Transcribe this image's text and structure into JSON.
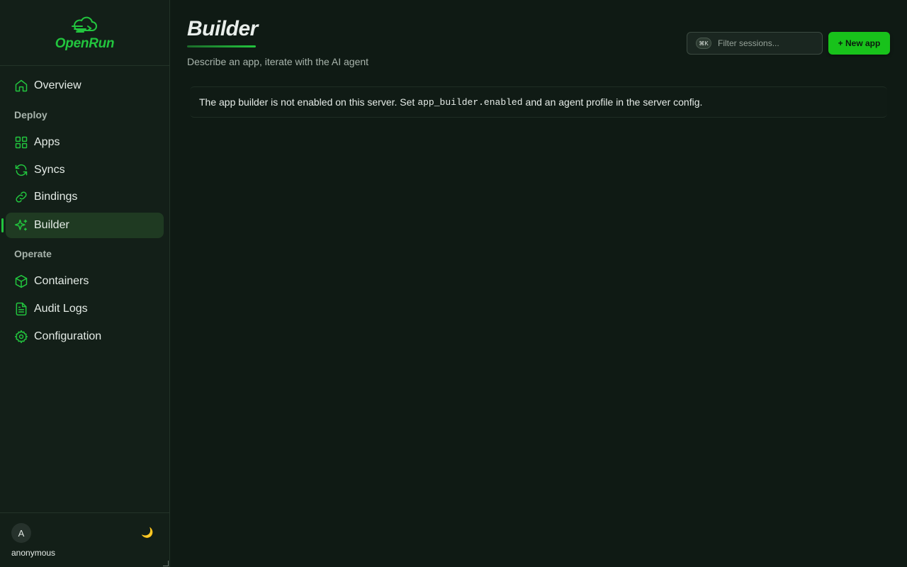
{
  "brand": {
    "name": "OpenRun",
    "logo_icon": "cloud-logo-icon",
    "accent": "#22c53e"
  },
  "sidebar": {
    "items": [
      {
        "label": "Overview",
        "icon": "home-icon"
      },
      {
        "label": "Apps",
        "icon": "grid-icon"
      },
      {
        "label": "Syncs",
        "icon": "refresh-icon"
      },
      {
        "label": "Bindings",
        "icon": "link-icon"
      },
      {
        "label": "Builder",
        "icon": "sparkle-icon",
        "active": true
      },
      {
        "label": "Containers",
        "icon": "box-icon"
      },
      {
        "label": "Audit Logs",
        "icon": "file-text-icon"
      },
      {
        "label": "Configuration",
        "icon": "gear-icon"
      }
    ],
    "sections": {
      "deploy": "Deploy",
      "operate": "Operate"
    },
    "footer": {
      "avatar_initial": "A",
      "username": "anonymous",
      "theme_icon": "🌙"
    }
  },
  "header": {
    "title": "Builder",
    "subtitle": "Describe an app, iterate with the AI agent",
    "search": {
      "placeholder": "Filter sessions...",
      "shortcut": "⌘K"
    },
    "new_button_label": "+ New app"
  },
  "notice": {
    "before": "The app builder is not enabled on this server. Set",
    "code": "app_builder.enabled",
    "after": "and an agent profile in the server config."
  }
}
